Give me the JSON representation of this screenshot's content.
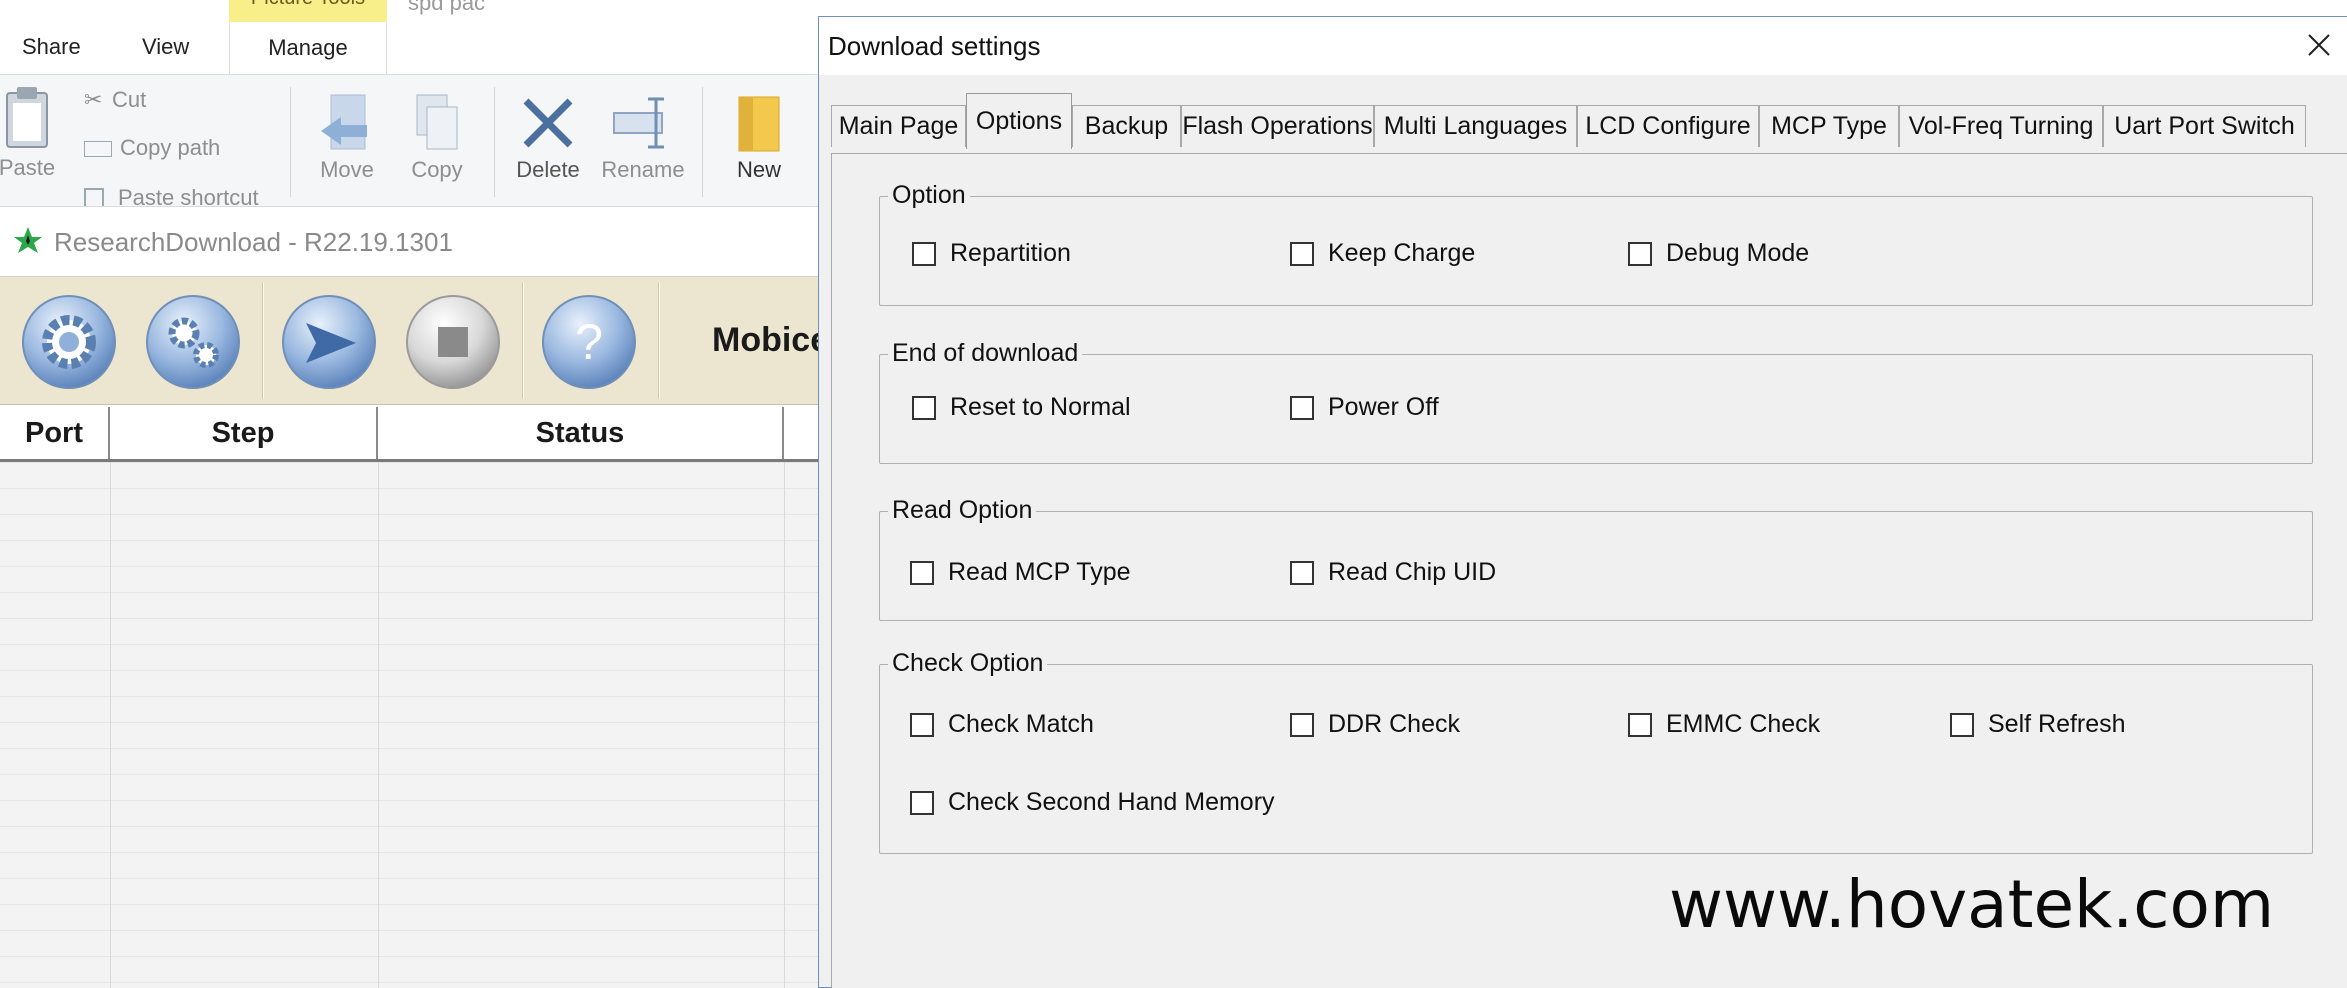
{
  "explorer": {
    "context_tab": "Picture Tools",
    "file_name": "spd pac",
    "tabs": [
      "Share",
      "View",
      "Manage"
    ],
    "buttons": {
      "paste": "Paste",
      "cut": "Cut",
      "copy_path": "Copy path",
      "paste_shortcut": "Paste shortcut",
      "move": "Move",
      "copy": "Copy",
      "delete": "Delete",
      "rename": "Rename",
      "new": "New"
    }
  },
  "research_download": {
    "title": "ResearchDownload - R22.19.1301",
    "brand": "Mobicel",
    "columns": [
      "Port",
      "Step",
      "Status"
    ],
    "toolbar_icons": [
      "gear-icon",
      "gears-icon",
      "play-icon",
      "stop-icon",
      "help-icon"
    ],
    "help_glyph": "?"
  },
  "dialog": {
    "title": "Download settings",
    "tabs": [
      "Main Page",
      "Options",
      "Backup",
      "Flash Operations",
      "Multi Languages",
      "LCD Configure",
      "MCP Type",
      "Vol-Freq Turning",
      "Uart Port Switch"
    ],
    "active_tab": "Options",
    "groups": {
      "option": {
        "title": "Option",
        "items": [
          {
            "label": "Repartition",
            "checked": false
          },
          {
            "label": "Keep Charge",
            "checked": false
          },
          {
            "label": "Debug Mode",
            "checked": false
          }
        ]
      },
      "end_of_download": {
        "title": "End of download",
        "items": [
          {
            "label": "Reset to Normal",
            "checked": false
          },
          {
            "label": "Power Off",
            "checked": false
          }
        ]
      },
      "read_option": {
        "title": "Read Option",
        "items": [
          {
            "label": "Read MCP Type",
            "checked": false
          },
          {
            "label": "Read Chip UID",
            "checked": false
          }
        ]
      },
      "check_option": {
        "title": "Check Option",
        "items": [
          {
            "label": "Check Match",
            "checked": false
          },
          {
            "label": "DDR Check",
            "checked": false
          },
          {
            "label": "EMMC Check",
            "checked": false
          },
          {
            "label": "Self Refresh",
            "checked": false
          },
          {
            "label": "Check Second Hand Memory",
            "checked": false
          }
        ]
      }
    }
  },
  "watermark": "www.hovatek.com",
  "colors": {
    "context_tab": "#f9ef8a",
    "toolbar_bg": "#ece5cf",
    "dialog_bg": "#f0f0f0",
    "dialog_border": "#6f8fc4"
  }
}
